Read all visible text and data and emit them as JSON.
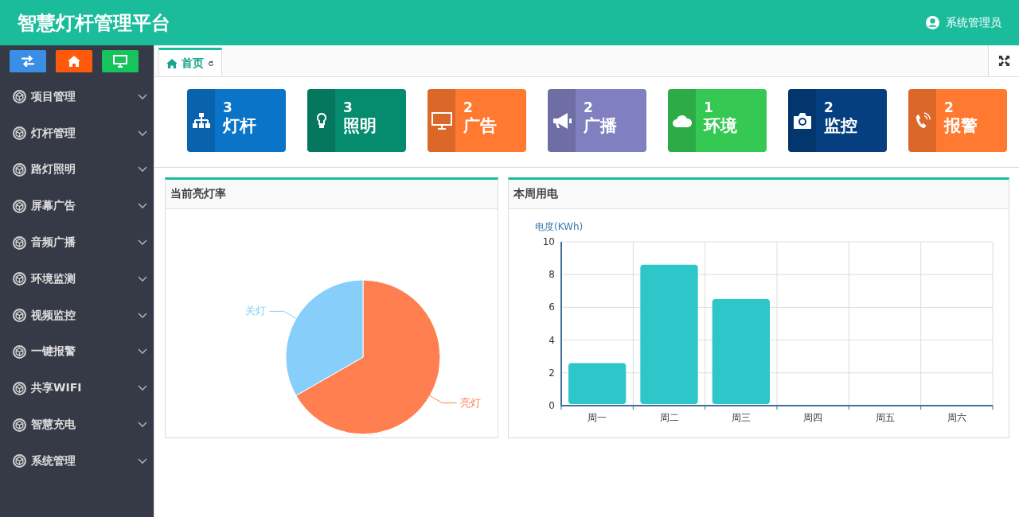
{
  "header": {
    "title": "智慧灯杆管理平台",
    "user": "系统管理员"
  },
  "quick_buttons": [
    {
      "kind": "switch",
      "color": "#3a8ee6"
    },
    {
      "kind": "home",
      "color": "#ff5a0b"
    },
    {
      "kind": "monitor",
      "color": "#16c35c"
    }
  ],
  "sidebar": {
    "items": [
      {
        "label": "项目管理",
        "expanded": false
      },
      {
        "label": "灯杆管理",
        "expanded": false
      },
      {
        "label": "路灯照明",
        "expanded": false
      },
      {
        "label": "屏幕广告",
        "expanded": false
      },
      {
        "label": "音频广播",
        "expanded": false
      },
      {
        "label": "环境监测",
        "expanded": false
      },
      {
        "label": "视频监控",
        "expanded": false
      },
      {
        "label": "一键报警",
        "expanded": false
      },
      {
        "label": "共享WIFI",
        "expanded": false
      },
      {
        "label": "智慧充电",
        "expanded": false
      },
      {
        "label": "系统管理",
        "expanded": false
      }
    ]
  },
  "tabs": [
    {
      "label": "首页",
      "selected": true
    }
  ],
  "tiles": [
    {
      "kind": "sitemap",
      "count": "3",
      "label": "灯杆",
      "color": "#0a74c9"
    },
    {
      "kind": "bulb",
      "count": "3",
      "label": "照明",
      "color": "#058b6e"
    },
    {
      "kind": "monitor",
      "count": "2",
      "label": "广告",
      "color": "#ff7a30"
    },
    {
      "kind": "megaphone",
      "count": "2",
      "label": "广播",
      "color": "#8080c0"
    },
    {
      "kind": "cloud",
      "count": "1",
      "label": "环境",
      "color": "#35c853"
    },
    {
      "kind": "camera",
      "count": "2",
      "label": "监控",
      "color": "#053f80"
    },
    {
      "kind": "phone",
      "count": "2",
      "label": "报警",
      "color": "#ff7a30"
    }
  ],
  "pie_panel": {
    "title": "当前亮灯率",
    "chart_data": {
      "type": "pie",
      "categories": [
        "亮灯",
        "关灯"
      ],
      "series": [
        {
          "values": [
            66.7,
            33.3
          ]
        }
      ],
      "colors": [
        "#ff7f50",
        "#87cefa"
      ]
    }
  },
  "bar_panel": {
    "title": "本周用电",
    "chart_data": {
      "type": "bar",
      "ylabel": "电度(KWh)",
      "categories": [
        "周一",
        "周二",
        "周三",
        "周四",
        "周五",
        "周六"
      ],
      "series": [
        {
          "color": "#2ec7c9",
          "values": [
            2.6,
            8.6,
            6.5,
            0,
            0,
            0
          ]
        }
      ],
      "grid": true,
      "ylim": [
        0,
        10
      ],
      "yticks": [
        0,
        2,
        4,
        6,
        8,
        10
      ]
    }
  }
}
